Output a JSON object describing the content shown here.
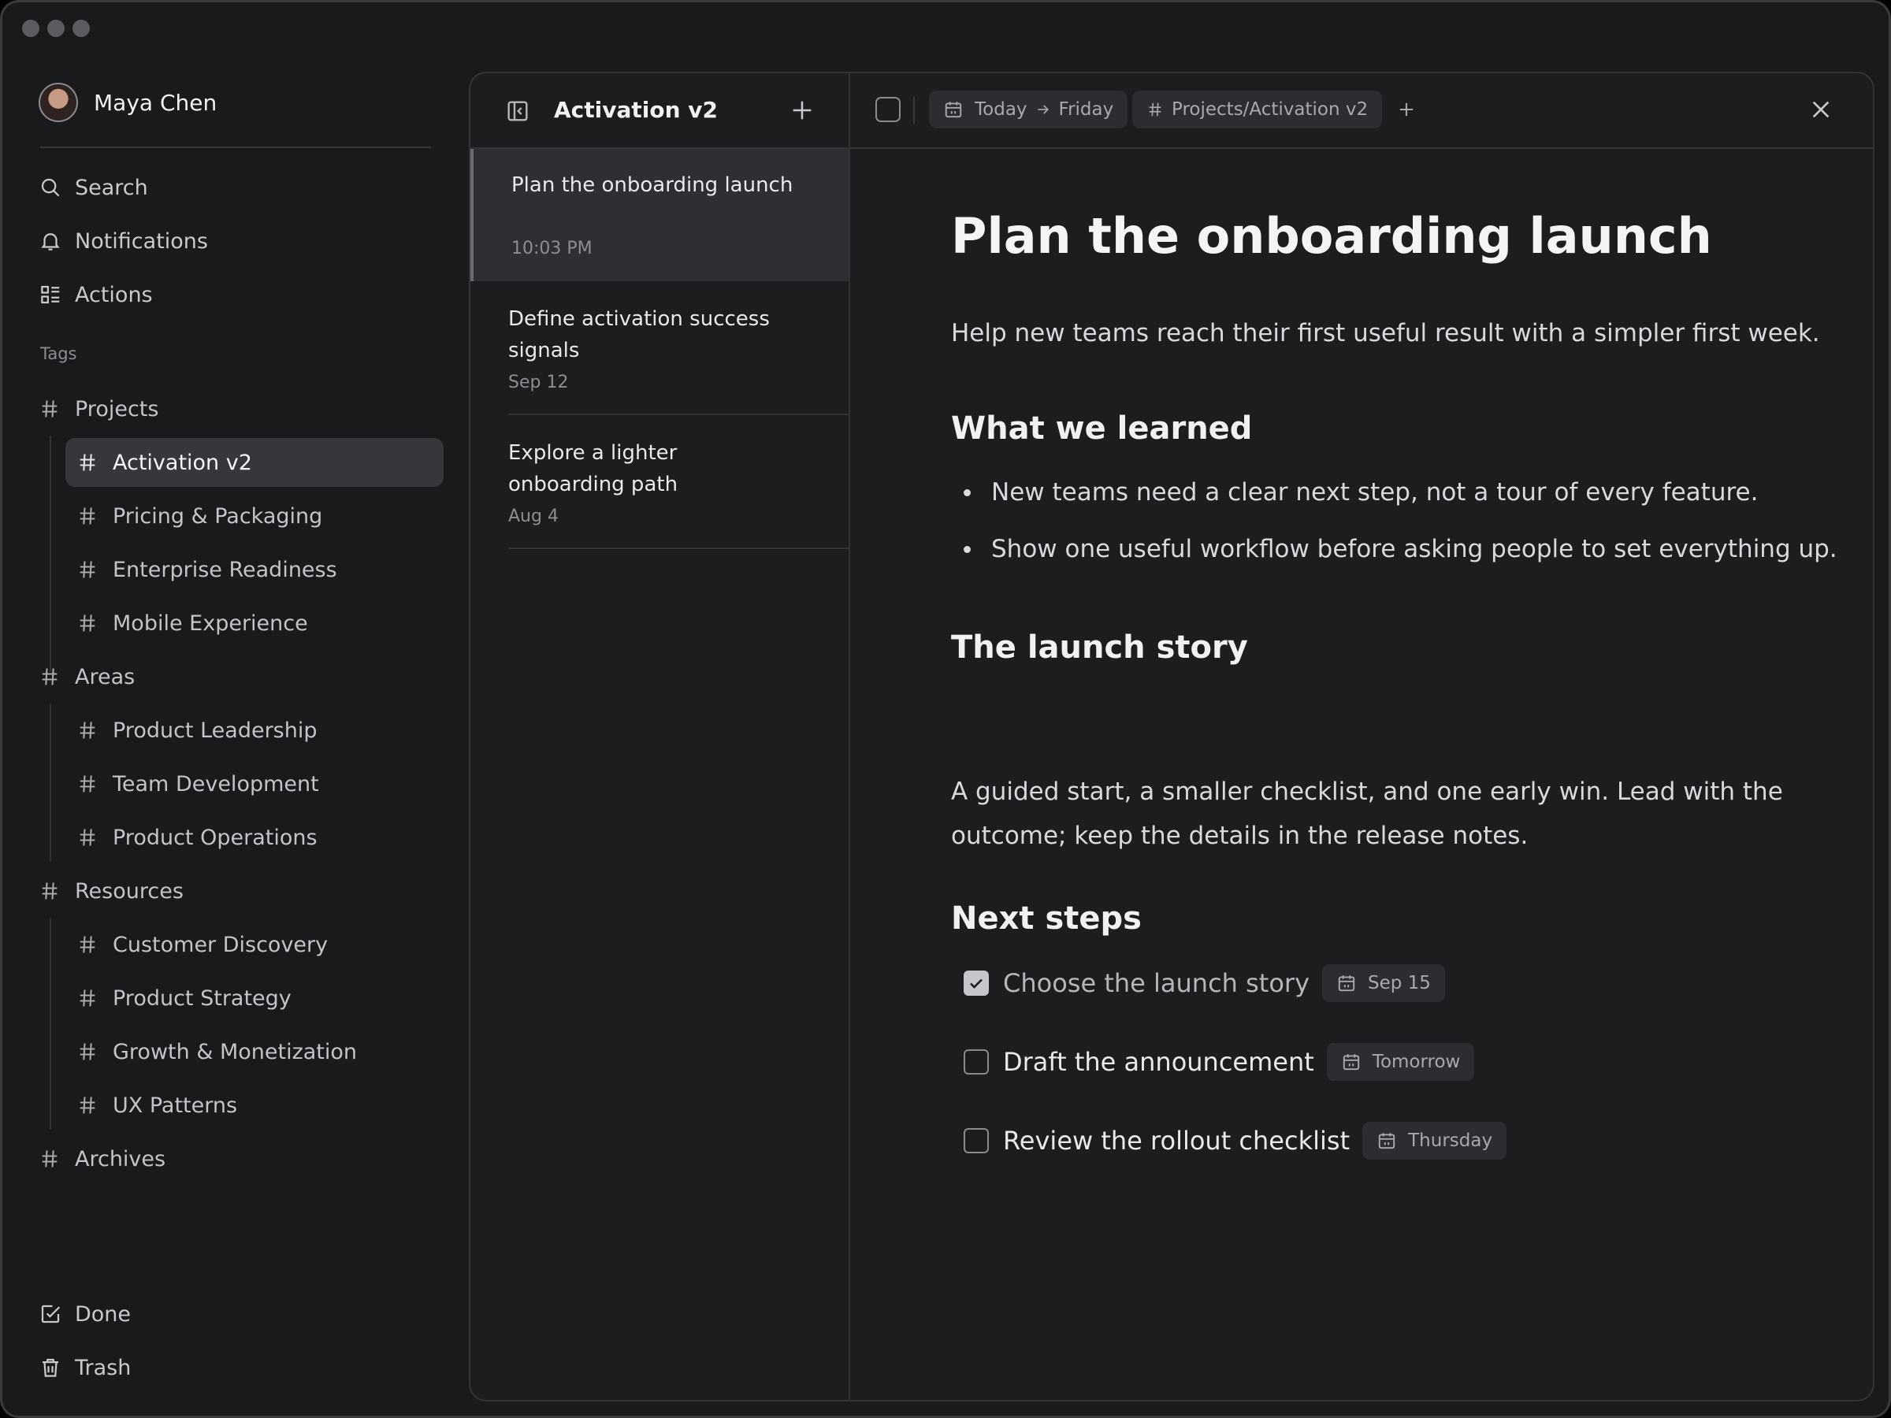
{
  "user": {
    "name": "Maya Chen"
  },
  "nav": {
    "search": "Search",
    "notifications": "Notifications",
    "actions": "Actions",
    "tags_heading": "Tags",
    "done": "Done",
    "trash": "Trash"
  },
  "tags": {
    "projects": {
      "label": "Projects",
      "children": [
        "Activation v2",
        "Pricing & Packaging",
        "Enterprise Readiness",
        "Mobile Experience"
      ]
    },
    "areas": {
      "label": "Areas",
      "children": [
        "Product Leadership",
        "Team Development",
        "Product Operations"
      ]
    },
    "resources": {
      "label": "Resources",
      "children": [
        "Customer Discovery",
        "Product Strategy",
        "Growth & Monetization",
        "UX Patterns"
      ]
    },
    "archives": {
      "label": "Archives"
    },
    "selected": "Activation v2"
  },
  "list": {
    "title": "Activation v2",
    "notes": [
      {
        "title": "Plan the onboarding launch",
        "date": "10:03 PM"
      },
      {
        "title": "Define activation success signals",
        "date": "Sep 12"
      },
      {
        "title": "Explore a lighter onboarding path",
        "date": "Aug 4"
      }
    ]
  },
  "editor": {
    "date_chip": {
      "from": "Today",
      "to": "Friday"
    },
    "tag_chip": "Projects/Activation v2",
    "title": "Plan the onboarding launch",
    "intro": "Help new teams reach their first useful result with a simpler first week.",
    "learned_heading": "What we learned",
    "learned": [
      "New teams need a clear next step, not a tour of every feature.",
      "Show one useful workflow before asking people to set everything up."
    ],
    "story_heading": "The launch story",
    "story": "A guided start, a smaller checklist, and one early win. Lead with the outcome; keep the details in the release notes.",
    "next_heading": "Next steps",
    "tasks": [
      {
        "label": "Choose the launch story",
        "due": "Sep 15",
        "done": true
      },
      {
        "label": "Draft the announcement",
        "due": "Tomorrow",
        "done": false
      },
      {
        "label": "Review the rollout checklist",
        "due": "Thursday",
        "done": false
      }
    ]
  },
  "colors": {
    "background": "#1a1a1d",
    "panel": "#1d1d20",
    "selected": "#36363b",
    "text": "#f1f1f3",
    "muted": "#8d8d92"
  }
}
